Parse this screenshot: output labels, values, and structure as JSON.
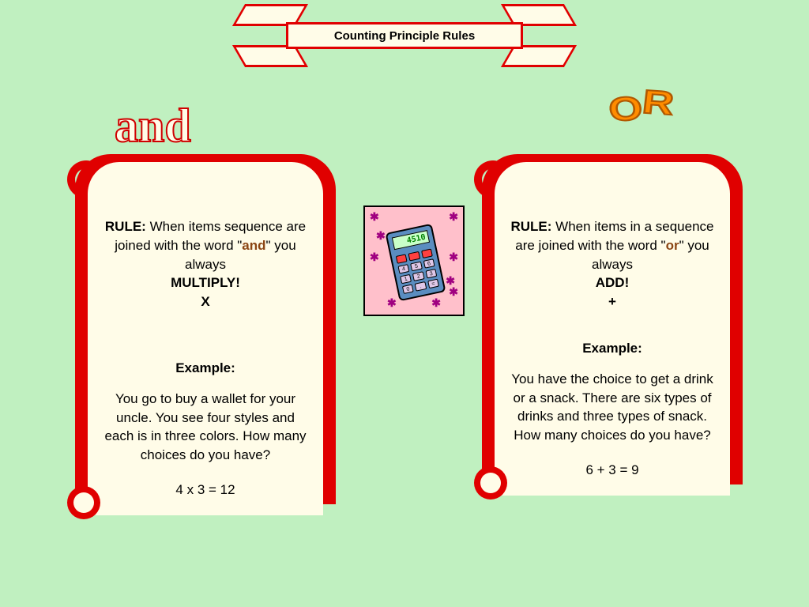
{
  "title": "Counting Principle Rules",
  "left": {
    "heading": "and",
    "rule_label": "RULE:",
    "rule_text1": "   When items sequence are joined with the word \"",
    "keyword": "and",
    "rule_text2": "\" you always",
    "action": "MULTIPLY!",
    "symbol": "X",
    "example_label": "Example:",
    "example_text": "You go to buy a wallet for your uncle. You see four styles and each is in three colors. How many choices do you have?",
    "answer": "4 x 3 = 12"
  },
  "right": {
    "heading": "OR",
    "rule_label": "RULE:",
    "rule_text1": "  When items in a sequence are joined with the word \"",
    "keyword": "or",
    "rule_text2": "\" you always",
    "action": "ADD!",
    "symbol": "+",
    "example_label": "Example:",
    "example_text": "You have the choice to get a drink or a snack. There are six types of drinks and three types of snack. How many choices do you have?",
    "answer": "6 + 3 = 9"
  },
  "calc": {
    "display": "4510",
    "stars": [
      "✱",
      "✱",
      "✱",
      "✱",
      "✱",
      "✱",
      "✱",
      "✱",
      "✱"
    ]
  }
}
